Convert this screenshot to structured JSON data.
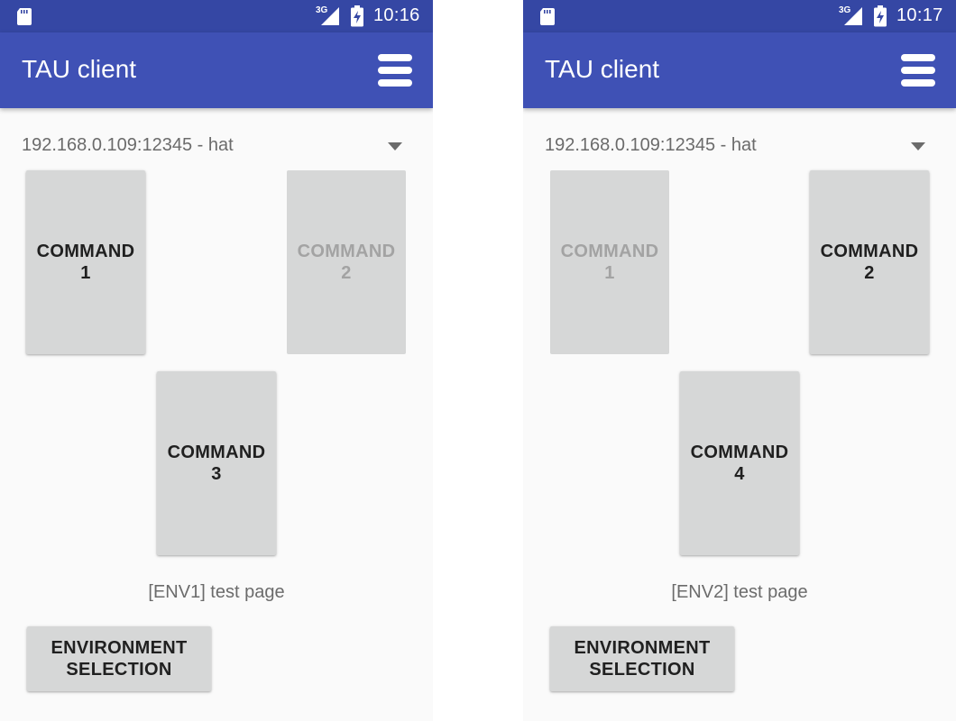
{
  "screens": [
    {
      "status_bar": {
        "network": "3G",
        "time": "10:16",
        "icons": [
          "sd-card-icon",
          "signal-icon",
          "battery-charging-icon"
        ]
      },
      "app_bar": {
        "title": "TAU client",
        "menu_icon": "menu-icon"
      },
      "server_select": {
        "value": "192.168.0.109:12345 - hat",
        "icon": "dropdown-arrow-icon"
      },
      "commands": [
        {
          "label": "COMMAND\n1",
          "enabled": true
        },
        {
          "label": "COMMAND\n2",
          "enabled": false
        },
        {
          "label": "COMMAND\n3",
          "enabled": true
        }
      ],
      "page_label": "[ENV1] test page",
      "env_button": {
        "label": "ENVIRONMENT\nSELECTION"
      }
    },
    {
      "status_bar": {
        "network": "3G",
        "time": "10:17",
        "icons": [
          "sd-card-icon",
          "signal-icon",
          "battery-charging-icon"
        ]
      },
      "app_bar": {
        "title": "TAU client",
        "menu_icon": "menu-icon"
      },
      "server_select": {
        "value": "192.168.0.109:12345 - hat",
        "icon": "dropdown-arrow-icon"
      },
      "commands": [
        {
          "label": "COMMAND\n1",
          "enabled": false
        },
        {
          "label": "COMMAND\n2",
          "enabled": true
        },
        {
          "label": "COMMAND\n4",
          "enabled": true
        }
      ],
      "page_label": "[ENV2] test page",
      "env_button": {
        "label": "ENVIRONMENT\nSELECTION"
      }
    }
  ],
  "colors": {
    "status_bar": "#3547a4",
    "app_bar": "#3f51b5",
    "background": "#fafafa",
    "button": "#d6d7d7",
    "button_text": "#202020",
    "disabled_text": "#a3a3a3",
    "secondary_text": "#6b6b6b"
  }
}
